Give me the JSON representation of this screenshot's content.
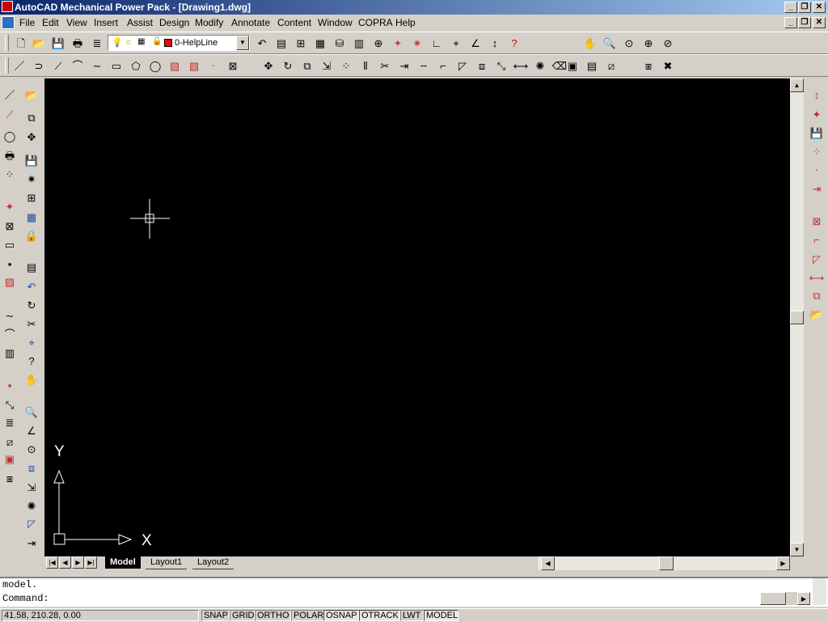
{
  "window": {
    "title": "AutoCAD Mechanical Power Pack - [Drawing1.dwg]"
  },
  "menu": [
    "File",
    "Edit",
    "View",
    "Insert",
    "Assist",
    "Design",
    "Modify",
    "Annotate",
    "Content",
    "Window",
    "COPRA",
    "Help"
  ],
  "layer": {
    "current": "0-HelpLine",
    "color": "#ff0000"
  },
  "tabs": {
    "model": "Model",
    "layout1": "Layout1",
    "layout2": "Layout2"
  },
  "ucs": {
    "x_label": "X",
    "y_label": "Y"
  },
  "command": {
    "history": "model.",
    "prompt": "Command:"
  },
  "status": {
    "coords": "41.58, 210.28, 0.00",
    "toggles": [
      "SNAP",
      "GRID",
      "ORTHO",
      "POLAR",
      "OSNAP",
      "OTRACK",
      "LWT",
      "MODEL"
    ],
    "pressed": [
      "OSNAP",
      "OTRACK",
      "MODEL"
    ]
  },
  "colors": {
    "canvas": "#000000",
    "titlebar_start": "#0a246a",
    "titlebar_end": "#a6caf0",
    "chrome": "#d4d0c8"
  },
  "icons": {
    "toolbar1": [
      "new-icon",
      "open-icon",
      "save-icon",
      "plot-icon",
      "layers-icon",
      "layer-on-icon",
      "layer-freeze-icon",
      "layer-lock-icon",
      "undo-icon",
      "properties-icon",
      "design-center-icon",
      "tool-palette-icon",
      "database-icon",
      "table-icon",
      "distance-icon",
      "dim-icon",
      "dim2-icon",
      "ortho-icon",
      "snap-icon",
      "axis-icon",
      "helpline-icon",
      "help-icon",
      "pan-icon",
      "zoom-realtime-icon",
      "zoom-window-icon",
      "zoom-previous-icon",
      "zoom-extents-icon"
    ],
    "toolbar2": [
      "line-icon",
      "polyline-icon",
      "xline-icon",
      "arc-icon",
      "spline-icon",
      "rectangle-icon",
      "polygon-icon",
      "circle-icon",
      "hatch-icon",
      "hatch2-icon",
      "point-icon",
      "block-icon",
      "move-icon",
      "rotate-icon",
      "copy-icon",
      "stretch-icon",
      "array-icon",
      "mirror-icon",
      "trim-icon",
      "extend-icon",
      "break-icon",
      "fillet-icon",
      "chamfer-icon",
      "offset-icon",
      "scale-icon",
      "lengthen-icon",
      "explode-icon",
      "erase-icon",
      "grips-icon",
      "properties2-icon",
      "layer-prev-icon",
      "match-icon",
      "delete-icon"
    ]
  }
}
